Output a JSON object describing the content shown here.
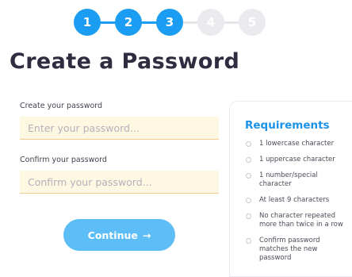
{
  "stepper": {
    "steps": [
      {
        "label": "1",
        "state": "done"
      },
      {
        "label": "2",
        "state": "done"
      },
      {
        "label": "3",
        "state": "done"
      },
      {
        "label": "4",
        "state": "todo"
      },
      {
        "label": "5",
        "state": "todo"
      }
    ],
    "active_color": "#1a9df2",
    "inactive_color": "#ebebef"
  },
  "page": {
    "title": "Create a Password"
  },
  "form": {
    "password": {
      "label": "Create your password",
      "placeholder": "Enter your password...",
      "value": ""
    },
    "confirm": {
      "label": "Confirm your password",
      "placeholder": "Confirm your password...",
      "value": ""
    },
    "continue_label": "Continue",
    "continue_icon": "arrow-right-icon",
    "continue_arrow": "→"
  },
  "requirements": {
    "title": "Requirements",
    "items": [
      "1 lowercase character",
      "1 uppercase character",
      "1 number/special character",
      "At least 9 characters",
      "No character repeated more than twice in a row",
      "Confirm password matches the new password"
    ]
  },
  "colors": {
    "accent": "#1a9df2",
    "button": "#5dbdf7",
    "input_bg": "#fef8e3",
    "input_border": "#f1cc8c",
    "title": "#2f2c40"
  }
}
